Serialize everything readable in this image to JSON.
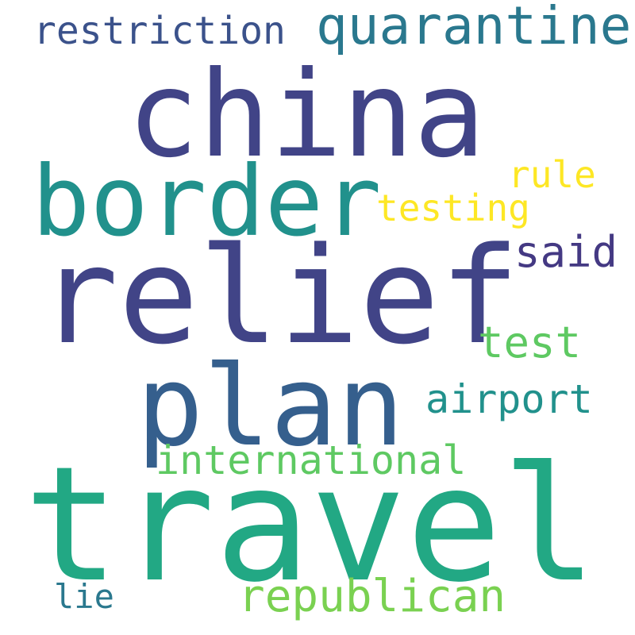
{
  "words": {
    "travel": {
      "text": "travel",
      "color": "#22a884"
    },
    "relief": {
      "text": "relief",
      "color": "#414487"
    },
    "china": {
      "text": "china",
      "color": "#414487"
    },
    "plan": {
      "text": "plan",
      "color": "#355f8d"
    },
    "border": {
      "text": "border",
      "color": "#21918c"
    },
    "quarantine": {
      "text": "quarantine",
      "color": "#2a788e"
    },
    "republican": {
      "text": "republican",
      "color": "#7ad151"
    },
    "international": {
      "text": "international",
      "color": "#5ec962"
    },
    "restriction": {
      "text": "restriction",
      "color": "#3b528b"
    },
    "said": {
      "text": "said",
      "color": "#443983"
    },
    "test": {
      "text": "test",
      "color": "#5ec962"
    },
    "airport": {
      "text": "airport",
      "color": "#21918c"
    },
    "testing": {
      "text": "testing",
      "color": "#fde725"
    },
    "rule": {
      "text": "rule",
      "color": "#fde725"
    },
    "lie": {
      "text": "lie",
      "color": "#2a788e"
    }
  }
}
